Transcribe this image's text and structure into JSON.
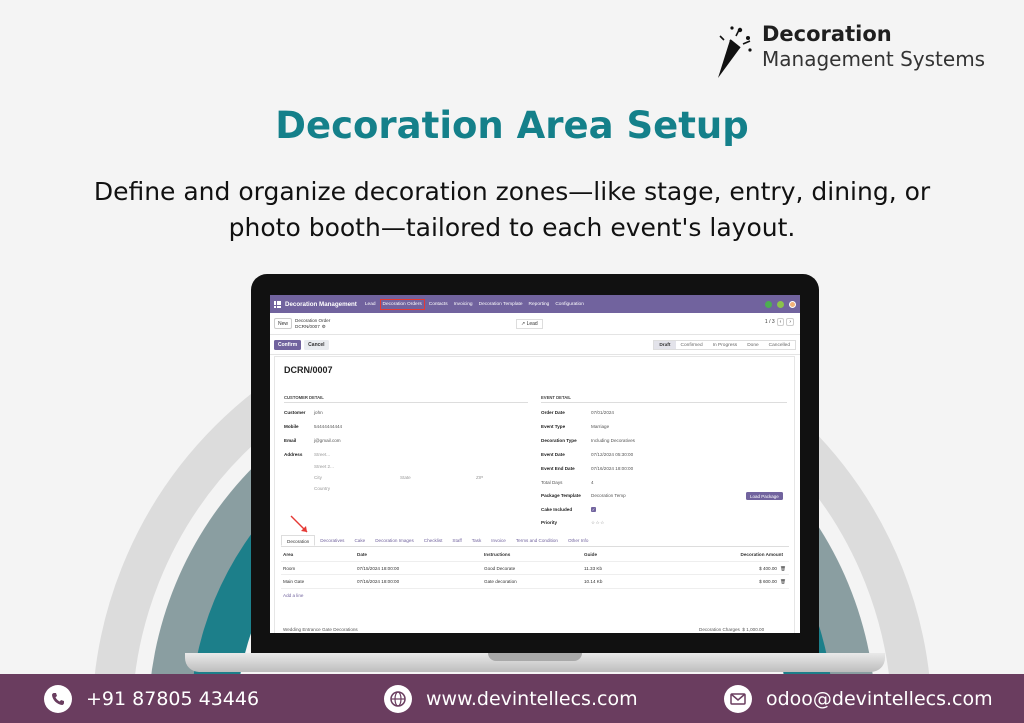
{
  "brand": {
    "name": "Decoration",
    "sub": "Management Systems"
  },
  "hero": {
    "title": "Decoration Area Setup",
    "subtitle_line1": "Define and organize decoration zones—like stage, entry, dining, or",
    "subtitle_line2": "photo booth—tailored to each event's layout."
  },
  "app": {
    "nav": {
      "app_name": "Decoration Management",
      "items": [
        "Lead",
        "Decoration Orders",
        "Contacts",
        "Invoicing",
        "Decoration Template",
        "Reporting",
        "Configuration"
      ]
    },
    "control": {
      "new_label": "New",
      "breadcrumb_parent": "Decoration Order",
      "breadcrumb_current": "DCRN/0007",
      "lead_label": "Lead",
      "pager": "1 / 3"
    },
    "status": {
      "confirm_label": "Confirm",
      "cancel_label": "Cancel",
      "stages": [
        "Draft",
        "Confirmed",
        "In Progress",
        "Done",
        "Cancelled"
      ],
      "active_stage": "Draft"
    },
    "record": {
      "name": "DCRN/0007",
      "customer_section": "CUSTOMER DETAIL",
      "event_section": "EVENT DETAIL",
      "customer": {
        "customer_label": "Customer",
        "customer_value": "john",
        "mobile_label": "Mobile",
        "mobile_value": "54444444444",
        "email_label": "Email",
        "email_value": "j@gmail.com",
        "address_label": "Address",
        "street_ph": "Street...",
        "street2_ph": "Street 2...",
        "city_ph": "City",
        "state_ph": "State",
        "zip_ph": "ZIP",
        "country_ph": "Country"
      },
      "event": {
        "order_date_label": "Order Date",
        "order_date_value": "07/01/2024",
        "event_type_label": "Event Type",
        "event_type_value": "Marriage",
        "decoration_type_label": "Decoration Type",
        "decoration_type_value": "Including Decoratives",
        "event_date_label": "Event Date",
        "event_date_value": "07/12/2024 05:30:00",
        "event_end_date_label": "Event End Date",
        "event_end_date_value": "07/16/2024 18:00:00",
        "total_days_label": "Total Days",
        "total_days_value": "4",
        "package_template_label": "Package Template",
        "package_template_value": "Decoration Temp",
        "cake_included_label": "Cake Included",
        "priority_label": "Priority",
        "load_package_label": "Load Package"
      },
      "tabs": [
        "Decoration",
        "Decoratives",
        "Cake",
        "Decoration Images",
        "Checklist",
        "Staff",
        "Task",
        "Invoice",
        "Terms and Condition",
        "Other Info"
      ],
      "active_tab": "Decoration",
      "lines": {
        "headers": {
          "area": "Area",
          "date": "Date",
          "instructions": "Instructions",
          "guide": "Guide",
          "amount": "Decoration Amount"
        },
        "rows": [
          {
            "area": "Room",
            "date": "07/15/2024 18:00:00",
            "instructions": "Good Decorate",
            "guide": "11.33 Kb",
            "amount": "$ 400.00"
          },
          {
            "area": "Main Gate",
            "date": "07/16/2024 18:00:00",
            "instructions": "Gate decoration",
            "guide": "10.14 Kb",
            "amount": "$ 600.00"
          }
        ],
        "add_line": "Add a line"
      },
      "footer_note": "Wedding Entrance Gate Decorations",
      "charge_label": "Decoration Charges",
      "charge_value": "$ 1,000.00"
    }
  },
  "contacts": {
    "phone": "+91 87805 43446",
    "web": "www.devintellecs.com",
    "email": "odoo@devintellecs.com"
  },
  "colors": {
    "teal": "#14808a",
    "plum": "#6a3d5f",
    "odoo_purple": "#71639e"
  }
}
